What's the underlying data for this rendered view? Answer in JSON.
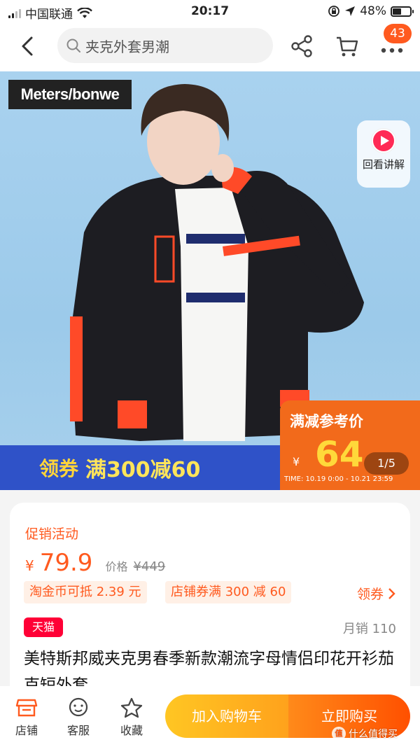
{
  "status_bar": {
    "carrier": "中国联通",
    "time": "20:17",
    "battery_text": "48%",
    "battery_level": 0.48
  },
  "nav": {
    "search_text": "夹克外套男潮",
    "badge_count": "43"
  },
  "hero": {
    "brand_logo": "Meters/bonwe",
    "replay_label": "回看讲解",
    "coupon_prefix": "领券",
    "coupon_text": "满300减60",
    "price_box_title": "满减参考价",
    "currency": "¥",
    "ref_price": "64",
    "time_range": "TIME: 10.19 0:00 - 10.21 23:59",
    "pager": "1/5"
  },
  "product": {
    "promo_label": "促销活动",
    "currency": "¥",
    "price": "79.9",
    "orig_price_label": "价格",
    "orig_price": "¥449",
    "tag_coins": "淘金币可抵 2.39 元",
    "tag_shop_coupon": "店铺券满 300 减 60",
    "coupon_link": "领券",
    "platform_badge": "天猫",
    "monthly_sales": "月销 110",
    "title": "美特斯邦威夹克男春季新款潮流字母情侣印花开衫茄克短外套"
  },
  "bottom_bar": {
    "shop": "店铺",
    "service": "客服",
    "favorite": "收藏",
    "add_to_cart": "加入购物车",
    "buy_now": "立即购买"
  },
  "watermark": {
    "mark": "值",
    "text": "什么值得买"
  },
  "colors": {
    "accent": "#ff5a1f",
    "tmall_red": "#ff0036",
    "cart_btn": "#ffb31f",
    "buy_btn": "#ff5a00",
    "coupon_strip": "#2f52c8",
    "price_box": "#f26a1b"
  }
}
